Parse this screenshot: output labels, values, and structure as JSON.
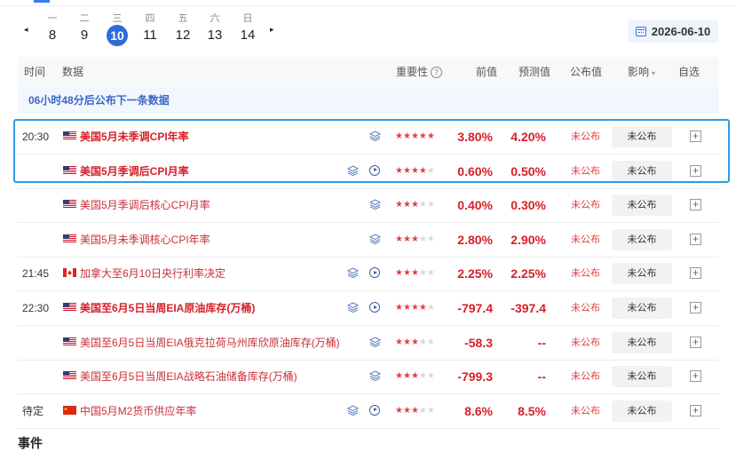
{
  "week": {
    "days": [
      {
        "wd": "一",
        "dn": "8"
      },
      {
        "wd": "二",
        "dn": "9"
      },
      {
        "wd": "三",
        "dn": "10"
      },
      {
        "wd": "四",
        "dn": "11"
      },
      {
        "wd": "五",
        "dn": "12"
      },
      {
        "wd": "六",
        "dn": "13"
      },
      {
        "wd": "日",
        "dn": "14"
      }
    ],
    "selected": "10",
    "prev_arrow": "◂",
    "next_arrow": "▸",
    "date": "2026-06-10"
  },
  "header": {
    "time": "时间",
    "data": "数据",
    "importance": "重要性",
    "prev": "前值",
    "forecast": "预测值",
    "actual": "公布值",
    "impact": "影响",
    "watch": "自选"
  },
  "notice": "06小时48分后公布下一条数据",
  "rows": [
    {
      "time": "20:30",
      "flag": "us",
      "name": "美国5月未季调CPI年率",
      "style": "red",
      "icons": [
        "layers"
      ],
      "stars": 5,
      "prev": "3.80%",
      "forecast": "4.20%",
      "actual": "未公布",
      "impact": "未公布"
    },
    {
      "time": "",
      "flag": "us",
      "name": "美国5月季调后CPI月率",
      "style": "red",
      "icons": [
        "layers",
        "play"
      ],
      "stars": 4,
      "prev": "0.60%",
      "forecast": "0.50%",
      "actual": "未公布",
      "impact": "未公布"
    },
    {
      "time": "",
      "flag": "us",
      "name": "美国5月季调后核心CPI月率",
      "style": "normal",
      "icons": [
        "layers"
      ],
      "stars": 3,
      "prev": "0.40%",
      "forecast": "0.30%",
      "actual": "未公布",
      "impact": "未公布"
    },
    {
      "time": "",
      "flag": "us",
      "name": "美国5月未季调核心CPI年率",
      "style": "normal",
      "icons": [
        "layers"
      ],
      "stars": 3,
      "prev": "2.80%",
      "forecast": "2.90%",
      "actual": "未公布",
      "impact": "未公布"
    },
    {
      "time": "21:45",
      "flag": "ca",
      "name": "加拿大至6月10日央行利率决定",
      "style": "normal",
      "icons": [
        "layers",
        "play"
      ],
      "stars": 3,
      "prev": "2.25%",
      "forecast": "2.25%",
      "actual": "未公布",
      "impact": "未公布"
    },
    {
      "time": "22:30",
      "flag": "us",
      "name": "美国至6月5日当周EIA原油库存(万桶)",
      "style": "red",
      "icons": [
        "layers",
        "play"
      ],
      "stars": 4,
      "prev": "-797.4",
      "forecast": "-397.4",
      "actual": "未公布",
      "impact": "未公布"
    },
    {
      "time": "",
      "flag": "us",
      "name": "美国至6月5日当周EIA俄克拉荷马州库欣原油库存(万桶)",
      "style": "normal",
      "icons": [
        "layers"
      ],
      "stars": 3,
      "prev": "-58.3",
      "forecast": "--",
      "actual": "未公布",
      "impact": "未公布"
    },
    {
      "time": "",
      "flag": "us",
      "name": "美国至6月5日当周EIA战略石油储备库存(万桶)",
      "style": "normal",
      "icons": [
        "layers"
      ],
      "stars": 3,
      "prev": "-799.3",
      "forecast": "--",
      "actual": "未公布",
      "impact": "未公布"
    },
    {
      "time": "待定",
      "flag": "cn",
      "name": "中国5月M2货币供应年率",
      "style": "normal",
      "icons": [
        "layers",
        "play"
      ],
      "stars": 3,
      "prev": "8.6%",
      "forecast": "8.5%",
      "actual": "未公布",
      "impact": "未公布"
    }
  ],
  "add_symbol": "+",
  "events_title": "事件",
  "colors": {
    "accent": "#2e6bd9",
    "red": "#d6202a",
    "highlight": "#2f9be6"
  }
}
